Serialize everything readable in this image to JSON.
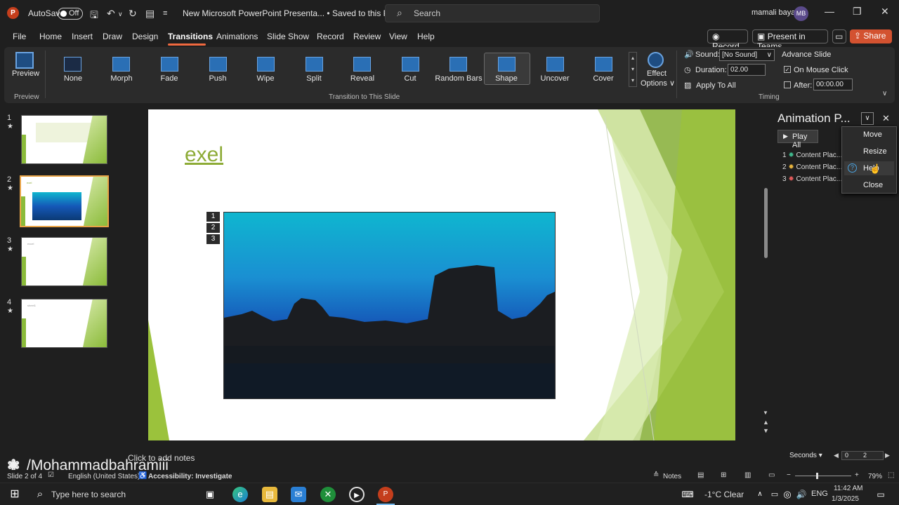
{
  "titlebar": {
    "app_logo": "P",
    "autosave_label": "AutoSave",
    "autosave_state": "Off",
    "doc_title": "New Microsoft PowerPoint Presenta... • Saved to this PC ∨",
    "search_placeholder": "Search",
    "user_name": "mamali bayat",
    "user_initials": "MB"
  },
  "menu": {
    "items": [
      "File",
      "Home",
      "Insert",
      "Draw",
      "Design",
      "Transitions",
      "Animations",
      "Slide Show",
      "Record",
      "Review",
      "View",
      "Help"
    ],
    "active": "Transitions",
    "record": "Record",
    "present_teams": "Present in Teams",
    "share": "Share"
  },
  "ribbon": {
    "preview": "Preview",
    "preview_group": "Preview",
    "transitions": [
      "None",
      "Morph",
      "Fade",
      "Push",
      "Wipe",
      "Split",
      "Reveal",
      "Cut",
      "Random Bars",
      "Shape",
      "Uncover",
      "Cover"
    ],
    "selected_transition": "Shape",
    "effect_options_1": "Effect",
    "effect_options_2": "Options ∨",
    "transition_group": "Transition to This Slide",
    "sound_label": "Sound:",
    "sound_value": "[No Sound]",
    "duration_label": "Duration:",
    "duration_value": "02.00",
    "apply_to_all": "Apply To All",
    "advance_slide": "Advance Slide",
    "on_mouse_click": "On Mouse Click",
    "after_label": "After:",
    "after_value": "00:00.00",
    "timing_group": "Timing"
  },
  "thumbnails": [
    {
      "num": "1",
      "star": "★"
    },
    {
      "num": "2",
      "star": "★",
      "selected": true,
      "small_title": "exel"
    },
    {
      "num": "3",
      "star": "★",
      "small_title": "excel"
    },
    {
      "num": "4",
      "star": "★",
      "small_title": "sheet1"
    }
  ],
  "slide": {
    "title": "exel",
    "anim_tags": [
      "1",
      "2",
      "3"
    ]
  },
  "animation_pane": {
    "title": "Animation P...",
    "play_all": "Play All",
    "items": [
      {
        "num": "1",
        "label": "Content Plac..."
      },
      {
        "num": "2",
        "label": "Content Plac..."
      },
      {
        "num": "3",
        "label": "Content Plac..."
      }
    ],
    "seconds_label": "Seconds ▾",
    "timeline_values": [
      "0",
      "2"
    ]
  },
  "context_menu": {
    "items": [
      "Move",
      "Resize",
      "Help",
      "Close"
    ]
  },
  "notes": {
    "placeholder": "Click to add notes",
    "watermark": "/Mohammadbahramiii"
  },
  "statusbar": {
    "slide_info": "Slide 2 of 4",
    "language": "English (United States)",
    "accessibility": "Accessibility: Investigate",
    "notes": "Notes",
    "zoom": "79%"
  },
  "taskbar": {
    "search_placeholder": "Type here to search",
    "weather": "-1°C  Clear",
    "lang": "ENG",
    "time": "11:42 AM",
    "date": "1/3/2025"
  },
  "colors": {
    "accent": "#f0693f",
    "share": "#d35230",
    "title_green": "#8dab36",
    "thumb_selected": "#e9a447"
  }
}
